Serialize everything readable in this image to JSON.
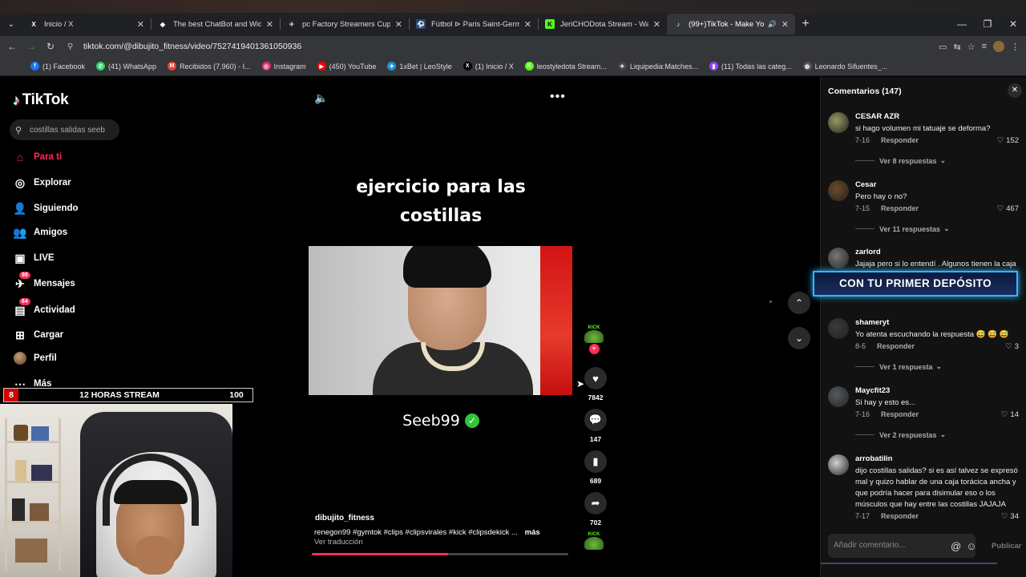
{
  "browser": {
    "tabs": [
      {
        "label": "Inicio / X",
        "favicon": "X"
      },
      {
        "label": "The best ChatBot and Widgets",
        "favicon": "◆"
      },
      {
        "label": "pc Factory Streamers Cup - Liq",
        "favicon": "✈"
      },
      {
        "label": "Fútbol ⊳ Paris Saint-Germain -",
        "favicon": "⚽"
      },
      {
        "label": "JeriCHODota Stream - Watch L",
        "favicon": "K"
      },
      {
        "label": "(99+)TikTok - Make Your Da",
        "favicon": "♪"
      }
    ],
    "url": "tiktok.com/@dibujito_fitness/video/7527419401361050936",
    "bookmarks": [
      {
        "label": "(1) Facebook",
        "color": "#1877f2",
        "glyph": "f"
      },
      {
        "label": "(41) WhatsApp",
        "color": "#25d366",
        "glyph": "✆"
      },
      {
        "label": "Recibidos (7.960) - I...",
        "color": "#ea4335",
        "glyph": "M"
      },
      {
        "label": "Instagram",
        "color": "#e1306c",
        "glyph": "◎"
      },
      {
        "label": "(450) YouTube",
        "color": "#ff0000",
        "glyph": "▶"
      },
      {
        "label": "1xBet | LeoStyle",
        "color": "#1d8fd6",
        "glyph": "✈"
      },
      {
        "label": "(1) Inicio / X",
        "color": "#000000",
        "glyph": "X"
      },
      {
        "label": "leostyledota Stream...",
        "color": "#53fc18",
        "glyph": "K"
      },
      {
        "label": "Liquipedia:Matches...",
        "color": "#444444",
        "glyph": "✈"
      },
      {
        "label": "(11) Todas las categ...",
        "color": "#9146ff",
        "glyph": "▮"
      },
      {
        "label": "Leonardo Sifuentes_...",
        "color": "#555555",
        "glyph": "◍"
      }
    ]
  },
  "tiktok": {
    "logo": "TikTok",
    "search_placeholder": "costillas salidas seeb",
    "nav": [
      {
        "label": "Para ti",
        "icon": "home-icon",
        "glyph": "⌂",
        "active": true
      },
      {
        "label": "Explorar",
        "icon": "compass-icon",
        "glyph": "◎"
      },
      {
        "label": "Siguiendo",
        "icon": "following-icon",
        "glyph": "👤"
      },
      {
        "label": "Amigos",
        "icon": "friends-icon",
        "glyph": "👥"
      },
      {
        "label": "LIVE",
        "icon": "live-icon",
        "glyph": "▣"
      },
      {
        "label": "Mensajes",
        "icon": "messages-icon",
        "glyph": "✈",
        "badge": "98"
      },
      {
        "label": "Actividad",
        "icon": "activity-icon",
        "glyph": "▤",
        "badge": "64"
      },
      {
        "label": "Cargar",
        "icon": "upload-icon",
        "glyph": "⊞"
      },
      {
        "label": "Perfil",
        "icon": "avatar",
        "glyph": ""
      },
      {
        "label": "Más",
        "icon": "more-icon",
        "glyph": "⋯"
      }
    ]
  },
  "stream_overlay": {
    "left_number": "8",
    "label": "12 HORAS STREAM",
    "right_number": "100"
  },
  "video": {
    "title_line1": "ejercicio para las",
    "title_line2": "costillas",
    "name": "Seeb99",
    "author": "dibujito_fitness",
    "hashtags": "renegon99 #gymtok #clips #clipsvirales #kick #clipsdekick ...",
    "more": "más",
    "translate": "Ver traducción",
    "progress": 0.53,
    "likes": "7842",
    "comments": "147",
    "saves": "689",
    "shares": "702",
    "kick_label": "KICK"
  },
  "comments": {
    "title": "Comentarios (147)",
    "items": [
      {
        "user": "CESAR AZR",
        "text": "si hago volumen mi tatuaje se deforma?",
        "date": "7-16",
        "reply": "Responder",
        "likes": "152",
        "replies": "Ver 8 respuestas",
        "avatar": "#9a9a60"
      },
      {
        "user": "Cesar",
        "text": "Pero hay o no?",
        "date": "7-15",
        "reply": "Responder",
        "likes": "467",
        "replies": "Ver 11 respuestas",
        "avatar": "#6b4a2a"
      },
      {
        "user": "zarlord",
        "text": "Jajaja pero si lo entendí . Algunos tienen la caja",
        "date": "",
        "reply": "",
        "likes": "",
        "replies": "",
        "avatar": "#777777"
      },
      {
        "user": "shameryt",
        "text": "Yo atenta escuchando la respuesta 😅 😅 😅",
        "date": "8-5",
        "reply": "Responder",
        "likes": "3",
        "replies": "Ver 1 respuesta",
        "avatar": "#3a3a3a"
      },
      {
        "user": "Maycfit23",
        "text": "Si hay y esto es...",
        "date": "7-16",
        "reply": "Responder",
        "likes": "14",
        "replies": "Ver 2 respuestas",
        "avatar": "#555a60"
      },
      {
        "user": "arrobatilin",
        "text": "dijo costillas salidas? si es así talvez se expresó mal y quizo hablar de una caja torácica ancha y que podría hacer para disimular eso o los músculos que hay entre las costillas JAJAJA",
        "date": "7-17",
        "reply": "Responder",
        "likes": "34",
        "replies": "",
        "avatar": "#d0d0d0"
      }
    ],
    "promo": "CON TU PRIMER DEPÓSITO",
    "input_placeholder": "Añadir comentario...",
    "publish": "Publicar"
  }
}
